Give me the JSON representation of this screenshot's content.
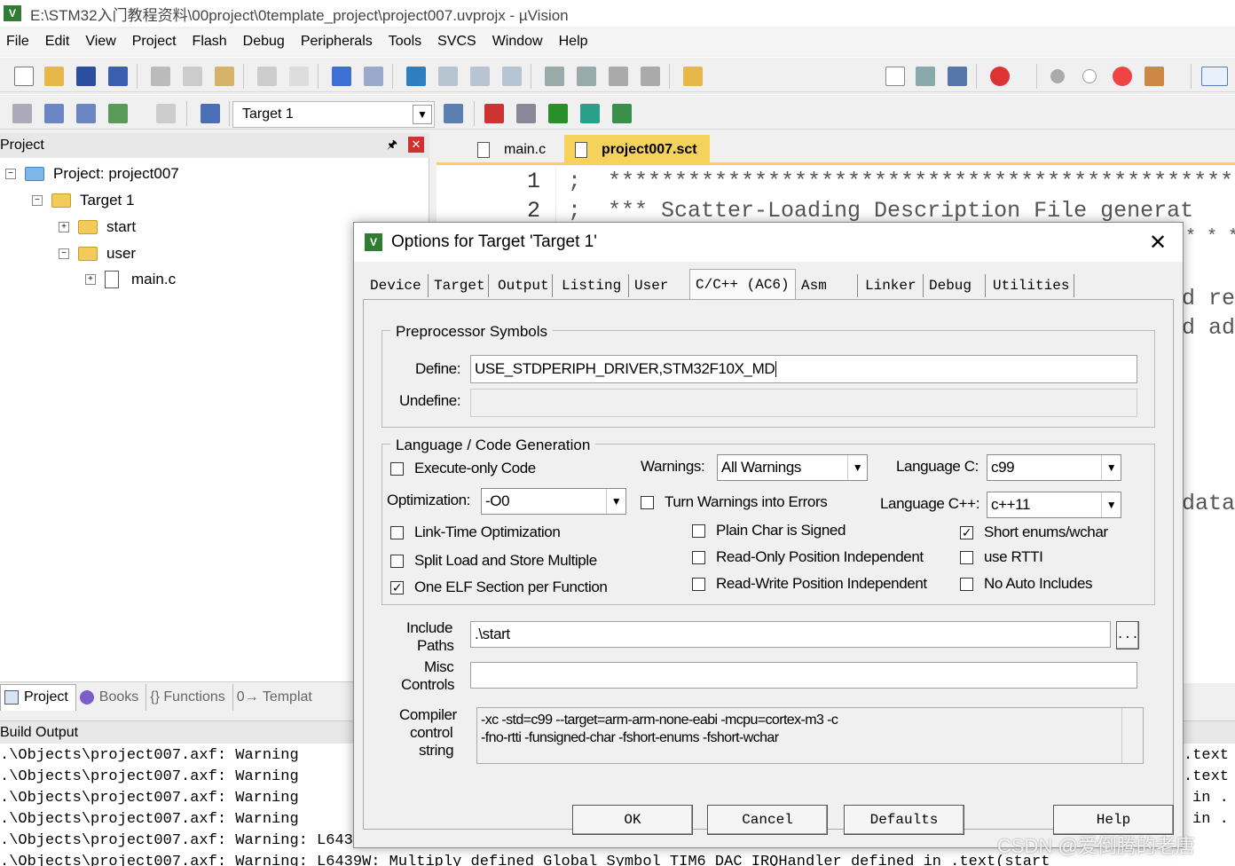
{
  "window": {
    "title": "E:\\STM32入门教程资料\\00project\\0template_project\\project007.uvprojx - µVision",
    "app_icon": "V"
  },
  "menu": [
    "File",
    "Edit",
    "View",
    "Project",
    "Flash",
    "Debug",
    "Peripherals",
    "Tools",
    "SVCS",
    "Window",
    "Help"
  ],
  "toolbar2": {
    "target": "Target 1"
  },
  "project_pane": {
    "header": "Project",
    "tree": [
      {
        "label": "Project: project007",
        "level": 0,
        "kind": "project"
      },
      {
        "label": "Target 1",
        "level": 1,
        "kind": "target"
      },
      {
        "label": "start",
        "level": 2,
        "kind": "folder"
      },
      {
        "label": "user",
        "level": 2,
        "kind": "folder"
      },
      {
        "label": "main.c",
        "level": 3,
        "kind": "file"
      }
    ],
    "tabs": [
      "Project",
      "Books",
      "{} Functions",
      "0→ Templat"
    ]
  },
  "editor": {
    "tabs": [
      "main.c",
      "project007.sct"
    ],
    "active_tab": "project007.sct",
    "lines": [
      {
        "num": "1",
        "text": ";  ***********************************************"
      },
      {
        "num": "2",
        "text": ";  *** Scatter-Loading Description File generat"
      }
    ],
    "right_fragments": [
      "* * * *",
      "d re",
      "d ad",
      "data"
    ]
  },
  "build_output": {
    "header": "Build Output",
    "lines": [
      ".\\Objects\\project007.axf: Warning",
      ".\\Objects\\project007.axf: Warning",
      ".\\Objects\\project007.axf: Warning",
      ".\\Objects\\project007.axf: Warning",
      ".\\Objects\\project007.axf: Warning: L6439W: Multiply defined Global Symbol TIM6_DAC_IRQHandler",
      ".\\Objects\\project007.axf: Warning: L6439W: Multiply defined Global Symbol TIM6_DAC_IRQHandler defined in .text(start"
    ],
    "right_fragments": [
      ".text",
      ".text",
      "in .",
      "in ."
    ]
  },
  "dialog": {
    "title": "Options for Target 'Target 1'",
    "tabs": [
      "Device",
      "Target",
      "Output",
      "Listing",
      "User",
      "C/C++ (AC6)",
      "Asm",
      "Linker",
      "Debug",
      "Utilities"
    ],
    "active_tab": "C/C++ (AC6)",
    "preprocessor": {
      "legend": "Preprocessor Symbols",
      "define_label": "Define:",
      "define_value": "USE_STDPERIPH_DRIVER,STM32F10X_MD",
      "undefine_label": "Undefine:",
      "undefine_value": ""
    },
    "language": {
      "legend": "Language / Code Generation",
      "execute_only": {
        "label": "Execute-only Code",
        "checked": false
      },
      "warnings_label": "Warnings:",
      "warnings_value": "All Warnings",
      "language_c_label": "Language C:",
      "language_c_value": "c99",
      "optimization_label": "Optimization:",
      "optimization_value": "-O0",
      "turn_warnings": {
        "label": "Turn Warnings into Errors",
        "checked": false
      },
      "language_cpp_label": "Language C++:",
      "language_cpp_value": "c++11",
      "lto": {
        "label": "Link-Time Optimization",
        "checked": false
      },
      "plain_char": {
        "label": "Plain Char is Signed",
        "checked": false
      },
      "short_enums": {
        "label": "Short enums/wchar",
        "checked": true
      },
      "split_load": {
        "label": "Split Load and Store Multiple",
        "checked": false
      },
      "ropi": {
        "label": "Read-Only Position Independent",
        "checked": false
      },
      "use_rtti": {
        "label": "use RTTI",
        "checked": false
      },
      "one_elf": {
        "label": "One ELF Section per Function",
        "checked": true
      },
      "rwpi": {
        "label": "Read-Write Position Independent",
        "checked": false
      },
      "no_auto_includes": {
        "label": "No Auto Includes",
        "checked": false
      }
    },
    "include_paths_label_1": "Include",
    "include_paths_label_2": "Paths",
    "include_paths_value": ".\\start",
    "browse_label": "...",
    "misc_label_1": "Misc",
    "misc_label_2": "Controls",
    "misc_value": "",
    "compiler_label_1": "Compiler",
    "compiler_label_2": "control",
    "compiler_label_3": "string",
    "compiler_line_1": "-xc -std=c99 --target=arm-arm-none-eabi -mcpu=cortex-m3 -c",
    "compiler_line_2": "-fno-rtti -funsigned-char -fshort-enums -fshort-wchar",
    "buttons": {
      "ok": "OK",
      "cancel": "Cancel",
      "defaults": "Defaults",
      "help": "Help"
    }
  },
  "watermark": "CSDN @爱倒腾的老唐",
  "colors": {
    "tab_accent": "#f5d25b",
    "close_red": "#d13030",
    "app_green": "#2e7d32"
  }
}
